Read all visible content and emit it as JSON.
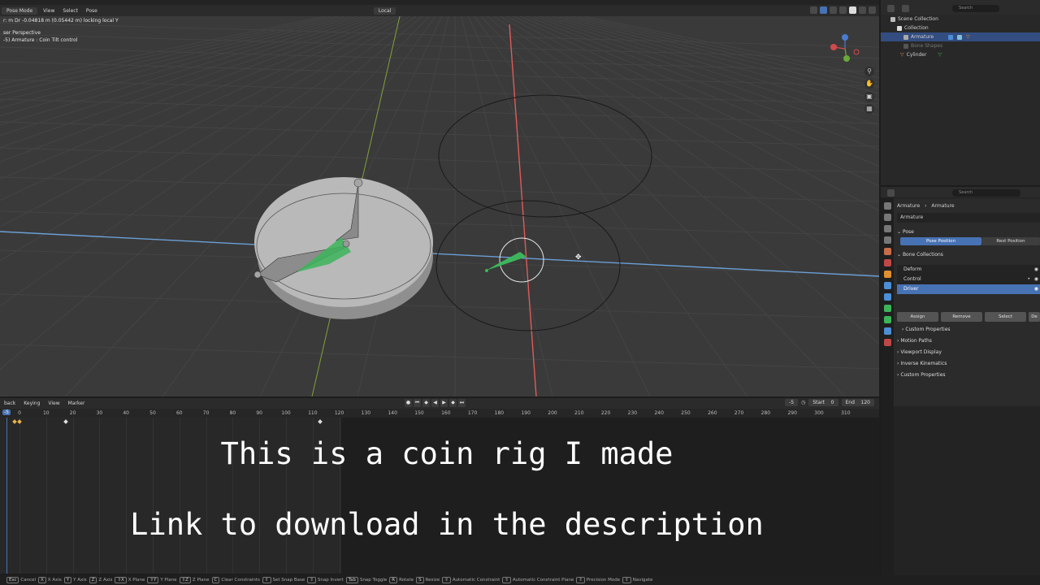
{
  "viewport": {
    "mode": "Pose Mode",
    "menus": [
      "View",
      "Select",
      "Pose"
    ],
    "transform_orientation": "Local",
    "info_line_1": "r: m  Dr -0.04818 m (0.05442 m) locking local Y",
    "info_line_2": "ser Perspective",
    "info_line_3": "-5) Armature : Coin Tilt control",
    "nav_icons": [
      "zoom-icon",
      "hand-icon",
      "camera-icon",
      "grid-icon"
    ]
  },
  "timeline": {
    "menus": [
      "back",
      "Keying",
      "View",
      "Marker"
    ],
    "current_frame": "-5",
    "start_label": "Start",
    "start_value": "0",
    "end_label": "End",
    "end_value": "120",
    "frame_field": "-5",
    "ticks": [
      "0",
      "10",
      "20",
      "30",
      "40",
      "50",
      "60",
      "70",
      "80",
      "90",
      "100",
      "110",
      "120",
      "130",
      "140",
      "150",
      "160",
      "170",
      "180",
      "190",
      "200",
      "210",
      "220",
      "230",
      "240",
      "250",
      "260",
      "270",
      "280",
      "290",
      "300",
      "310"
    ],
    "playhead_marker": "-5"
  },
  "captions": {
    "line_1": "This is a coin rig I made",
    "line_2": "Link to download in the description"
  },
  "outliner": {
    "search_placeholder": "Search",
    "rows": [
      "Scene Collection",
      "Collection",
      "Armature",
      "Bone Shapes",
      "Cylinder"
    ]
  },
  "properties": {
    "search_placeholder": "Search",
    "breadcrumb_1": "Armature",
    "breadcrumb_2": "Armature",
    "data_name": "Armature",
    "pose_panel": "Pose",
    "pose_position": "Pose Position",
    "rest_position": "Rest Position",
    "bone_collections_panel": "Bone Collections",
    "collections": [
      "Deform",
      "Control",
      "Driver"
    ],
    "assign": "Assign",
    "remove": "Remove",
    "select": "Select",
    "deselect": "De",
    "custom_properties": "Custom Properties",
    "motion_paths": "Motion Paths",
    "viewport_display": "Viewport Display",
    "inverse_kinematics": "Inverse Kinematics",
    "custom_properties_2": "Custom Properties"
  },
  "status_bar": [
    {
      "key": "Esc",
      "label": "Cancel"
    },
    {
      "key": "X",
      "label": "X Axis"
    },
    {
      "key": "Y",
      "label": "Y Axis"
    },
    {
      "key": "Z",
      "label": "Z Axis"
    },
    {
      "key": "⇧X",
      "label": "X Plane"
    },
    {
      "key": "⇧Y",
      "label": "Y Plane"
    },
    {
      "key": "⇧Z",
      "label": "Z Plane"
    },
    {
      "key": "C",
      "label": "Clear Constraints"
    },
    {
      "key": "⇧",
      "label": "Set Snap Base"
    },
    {
      "key": "⇧",
      "label": "Snap Invert"
    },
    {
      "key": "Tab",
      "label": "Snap Toggle"
    },
    {
      "key": "R",
      "label": "Rotate"
    },
    {
      "key": "S",
      "label": "Resize"
    },
    {
      "key": "⇧",
      "label": "Automatic Constraint"
    },
    {
      "key": "⇧",
      "label": "Automatic Constraint Plane"
    },
    {
      "key": "⇧",
      "label": "Precision Mode"
    },
    {
      "key": "⇧",
      "label": "Navigate"
    }
  ],
  "colors": {
    "accent": "#4772b3",
    "x_axis": "#e05a5a",
    "y_axis": "#7fa23a",
    "bone_green": "#3cb55a",
    "keyframe": "#e8b24a"
  }
}
